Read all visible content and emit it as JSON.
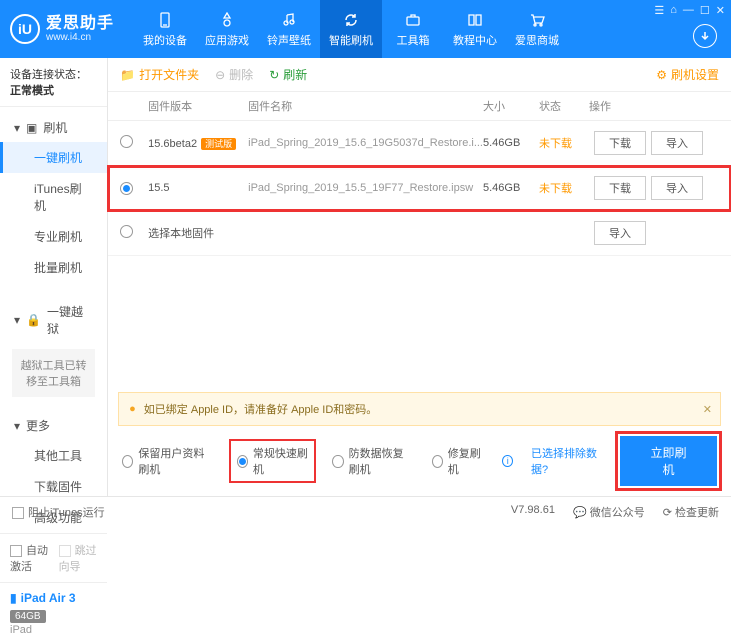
{
  "brand": {
    "name": "爱思助手",
    "url": "www.i4.cn"
  },
  "nav": [
    {
      "label": "我的设备"
    },
    {
      "label": "应用游戏"
    },
    {
      "label": "铃声壁纸"
    },
    {
      "label": "智能刷机"
    },
    {
      "label": "工具箱"
    },
    {
      "label": "教程中心"
    },
    {
      "label": "爱思商城"
    }
  ],
  "sidebar": {
    "status_prefix": "设备连接状态：",
    "status_value": "正常模式",
    "group_flash": "刷机",
    "items_flash": [
      "一键刷机",
      "iTunes刷机",
      "专业刷机",
      "批量刷机"
    ],
    "group_jail": "一键越狱",
    "jail_note": "越狱工具已转移至工具箱",
    "group_more": "更多",
    "items_more": [
      "其他工具",
      "下载固件",
      "高级功能"
    ],
    "auto_activate": "自动激活",
    "skip_guide": "跳过向导"
  },
  "device": {
    "name": "iPad Air 3",
    "storage": "64GB",
    "type": "iPad"
  },
  "toolbar": {
    "open_folder": "打开文件夹",
    "delete": "删除",
    "refresh": "刷新",
    "settings": "刷机设置"
  },
  "table": {
    "headers": {
      "version": "固件版本",
      "name": "固件名称",
      "size": "大小",
      "status": "状态",
      "ops": "操作"
    },
    "rows": [
      {
        "version": "15.6beta2",
        "beta": "测试版",
        "name": "iPad_Spring_2019_15.6_19G5037d_Restore.i...",
        "size": "5.46GB",
        "status": "未下载",
        "download": "下载",
        "import": "导入",
        "selected": false
      },
      {
        "version": "15.5",
        "beta": "",
        "name": "iPad_Spring_2019_15.5_19F77_Restore.ipsw",
        "size": "5.46GB",
        "status": "未下载",
        "download": "下载",
        "import": "导入",
        "selected": true
      }
    ],
    "local_row": {
      "label": "选择本地固件",
      "import": "导入"
    }
  },
  "warning": {
    "text": "如已绑定 Apple ID，请准备好 Apple ID和密码。"
  },
  "modes": {
    "keep_data": "保留用户资料刷机",
    "normal": "常规快速刷机",
    "anti_recovery": "防数据恢复刷机",
    "repair": "修复刷机",
    "exclude_link": "已选择排除数据?",
    "flash_btn": "立即刷机"
  },
  "statusbar": {
    "block_itunes": "阻止iTunes运行",
    "version": "V7.98.61",
    "wechat": "微信公众号",
    "check_update": "检查更新"
  }
}
